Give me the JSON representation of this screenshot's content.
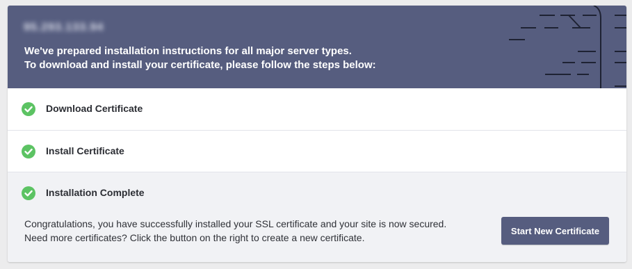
{
  "banner": {
    "ip_blurred": "95.293.133.94",
    "intro_line1": "We've prepared installation instructions for all major server types.",
    "intro_line2": "To download and install your certificate, please follow the steps below:",
    "background_color": "#565d7f"
  },
  "steps": [
    {
      "label": "Download Certificate",
      "status": "complete",
      "icon": "check-circle-icon"
    },
    {
      "label": "Install Certificate",
      "status": "complete",
      "icon": "check-circle-icon"
    },
    {
      "label": "Installation Complete",
      "status": "complete",
      "icon": "check-circle-icon"
    }
  ],
  "completion": {
    "message": "Congratulations, you have successfully installed your SSL certificate and your site is now secured. Need more certificates? Click the button on the right to create a new certificate.",
    "button_label": "Start New Certificate"
  },
  "colors": {
    "accent": "#565d7f",
    "success": "#5cc363"
  }
}
